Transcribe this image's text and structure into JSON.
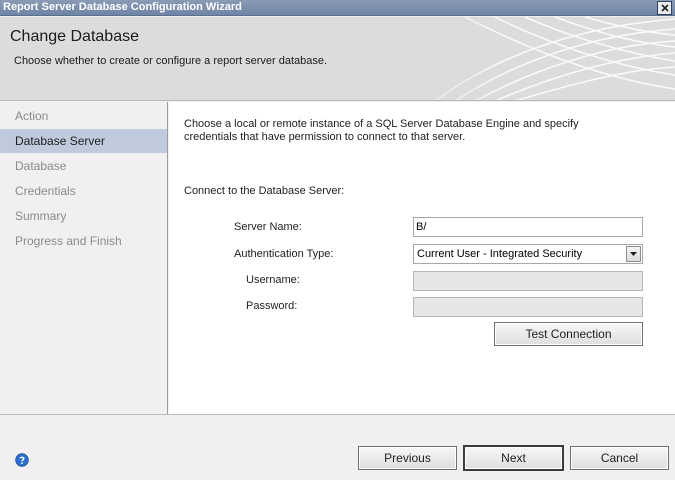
{
  "window": {
    "title": "Report Server Database Configuration Wizard",
    "close_icon": "close-icon"
  },
  "header": {
    "title": "Change Database",
    "subtitle": "Choose whether to create or configure a report server database."
  },
  "nav": {
    "items": [
      {
        "label": "Action",
        "selected": false
      },
      {
        "label": "Database Server",
        "selected": true
      },
      {
        "label": "Database",
        "selected": false
      },
      {
        "label": "Credentials",
        "selected": false
      },
      {
        "label": "Summary",
        "selected": false
      },
      {
        "label": "Progress and Finish",
        "selected": false
      }
    ]
  },
  "content": {
    "intro": "Choose a local or remote instance of a SQL Server Database Engine and specify credentials that have permission to connect to that server.",
    "connect_label": "Connect to the Database Server:",
    "server_name": {
      "label": "Server Name:",
      "value": "B/"
    },
    "auth_type": {
      "label": "Authentication Type:",
      "value": "Current User - Integrated Security"
    },
    "username": {
      "label": "Username:",
      "value": ""
    },
    "password": {
      "label": "Password:",
      "value": ""
    },
    "test_connection": "Test Connection"
  },
  "footer": {
    "help_icon": "help-icon",
    "previous": "Previous",
    "next": "Next",
    "cancel": "Cancel"
  },
  "colors": {
    "titlebar": "#7a8eac",
    "nav_selected": "#bfcbdc",
    "help_icon": "#2c6fd1"
  }
}
